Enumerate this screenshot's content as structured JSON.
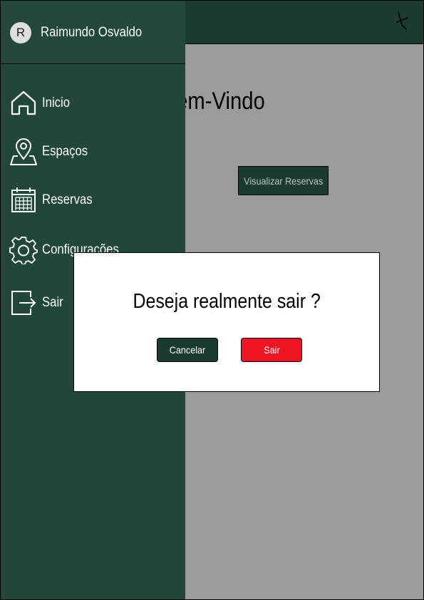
{
  "header": {
    "close_icon": "close-icon"
  },
  "main": {
    "welcome_text": "Seja Bem-Vindo",
    "view_reservations_label": "Visualizar Reservas"
  },
  "drawer": {
    "user": {
      "initial": "R",
      "name": "Raimundo Osvaldo"
    },
    "items": [
      {
        "label": "Inicio",
        "icon": "home-icon"
      },
      {
        "label": "Espaços",
        "icon": "map-pin-icon"
      },
      {
        "label": "Reservas",
        "icon": "calendar-icon"
      },
      {
        "label": "Configurações",
        "icon": "gear-icon"
      },
      {
        "label": "Sair",
        "icon": "logout-icon"
      }
    ]
  },
  "dialog": {
    "title": "Deseja realmente sair ?",
    "cancel_label": "Cancelar",
    "confirm_label": "Sair"
  },
  "colors": {
    "dark_green": "#1c3b30",
    "drawer_green": "#21463a",
    "overlay_gray": "#9b9b9b",
    "danger_red": "#ee1522"
  }
}
